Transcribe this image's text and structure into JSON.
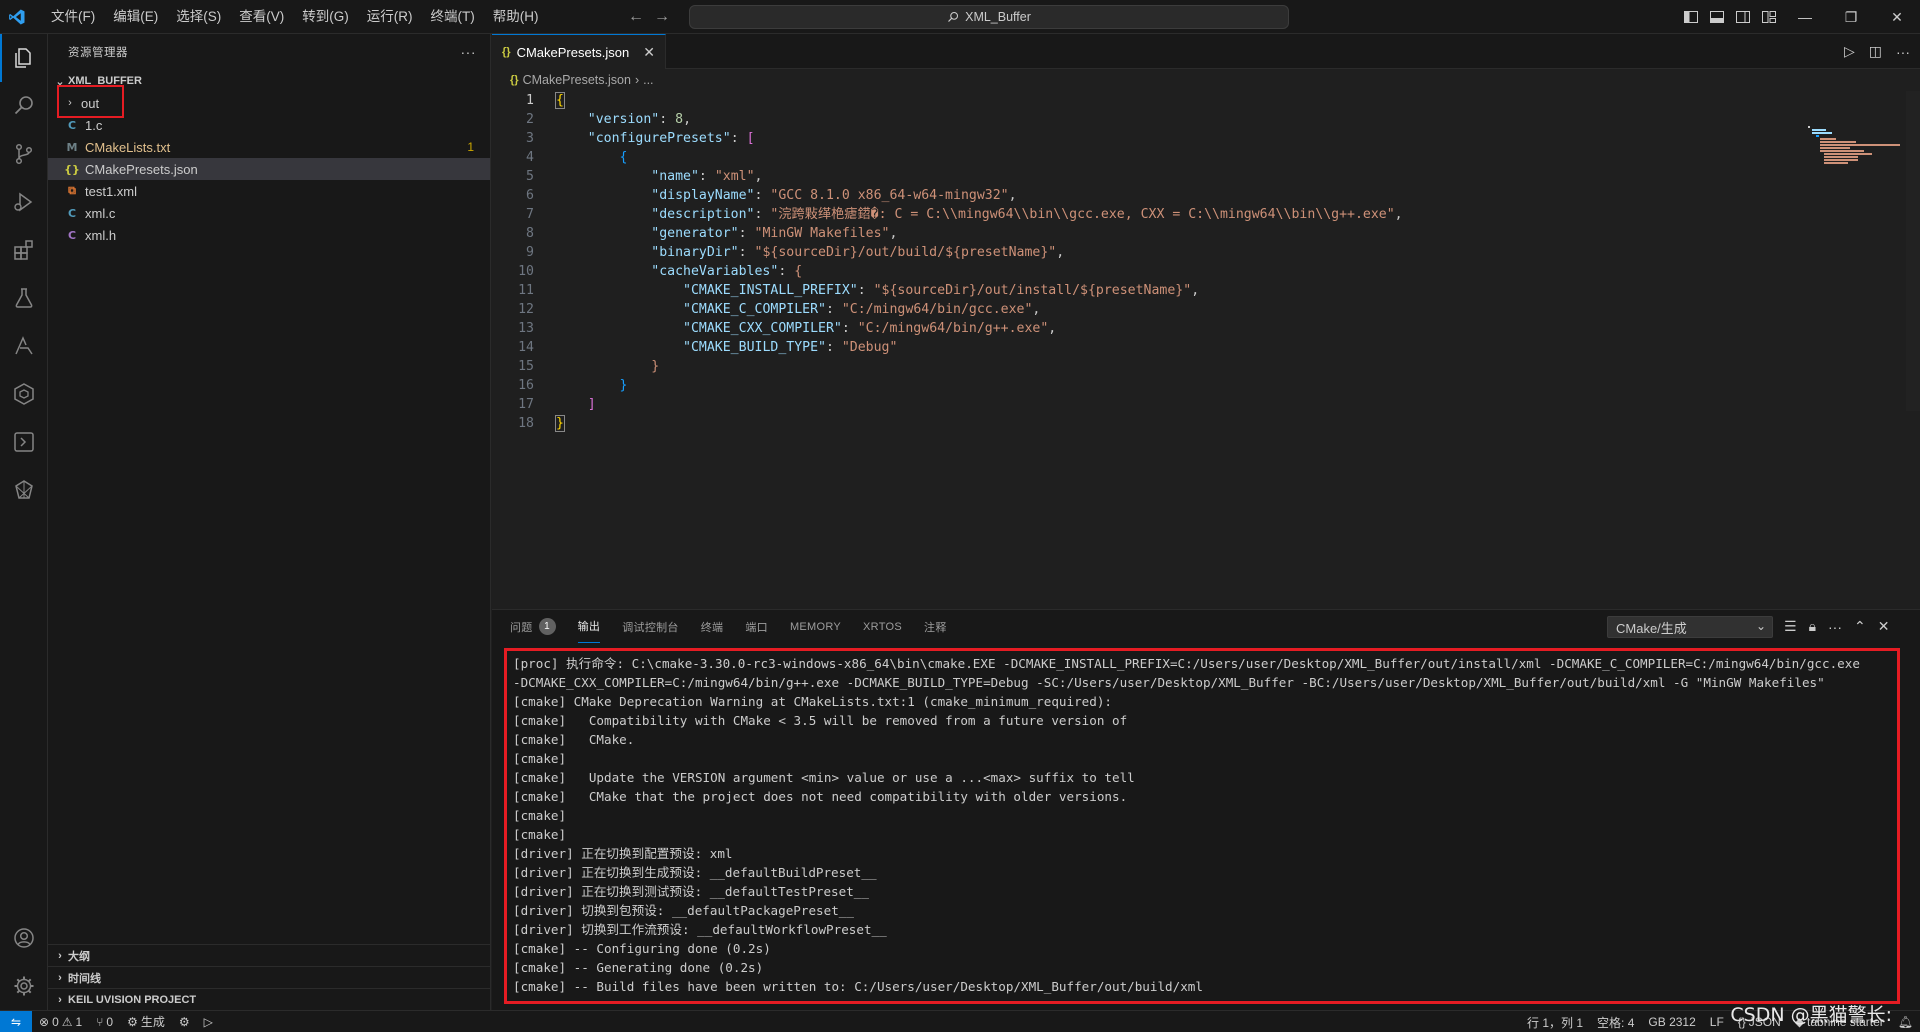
{
  "titlebar": {
    "menu": [
      "文件(F)",
      "编辑(E)",
      "选择(S)",
      "查看(V)",
      "转到(G)",
      "运行(R)",
      "终端(T)",
      "帮助(H)"
    ],
    "search_text": "XML_Buffer"
  },
  "sidebar": {
    "title": "资源管理器",
    "project": "XML_BUFFER",
    "items": [
      {
        "label": "out",
        "type": "folder"
      },
      {
        "label": "1.c",
        "type": "c"
      },
      {
        "label": "CMakeLists.txt",
        "type": "cmake",
        "badge": "1"
      },
      {
        "label": "CMakePresets.json",
        "type": "json"
      },
      {
        "label": "test1.xml",
        "type": "xml"
      },
      {
        "label": "xml.c",
        "type": "c"
      },
      {
        "label": "xml.h",
        "type": "h"
      }
    ],
    "bottom_sections": [
      "大纲",
      "时间线",
      "KEIL UVISION PROJECT"
    ]
  },
  "editor": {
    "tab_label": "CMakePresets.json",
    "breadcrumb_file": "CMakePresets.json",
    "breadcrumb_more": "...",
    "line_numbers": [
      "1",
      "2",
      "3",
      "4",
      "5",
      "6",
      "7",
      "8",
      "9",
      "10",
      "11",
      "12",
      "13",
      "14",
      "15",
      "16",
      "17",
      "18"
    ],
    "code": {
      "version_key": "\"version\"",
      "version_val": "8",
      "presets_key": "\"configurePresets\"",
      "name_key": "\"name\"",
      "name_val": "\"xml\"",
      "display_key": "\"displayName\"",
      "display_val": "\"GCC 8.1.0 x86_64-w64-mingw32\"",
      "desc_key": "\"description\"",
      "desc_val": "\"浣跨敤缂栬瘧鍣�: C = C:\\\\mingw64\\\\bin\\\\gcc.exe, CXX = C:\\\\mingw64\\\\bin\\\\g++.exe\"",
      "gen_key": "\"generator\"",
      "gen_val": "\"MinGW Makefiles\"",
      "bin_key": "\"binaryDir\"",
      "bin_val": "\"${sourceDir}/out/build/${presetName}\"",
      "cache_key": "\"cacheVariables\"",
      "inst_key": "\"CMAKE_INSTALL_PREFIX\"",
      "inst_val": "\"${sourceDir}/out/install/${presetName}\"",
      "cc_key": "\"CMAKE_C_COMPILER\"",
      "cc_val": "\"C:/mingw64/bin/gcc.exe\"",
      "cxx_key": "\"CMAKE_CXX_COMPILER\"",
      "cxx_val": "\"C:/mingw64/bin/g++.exe\"",
      "bt_key": "\"CMAKE_BUILD_TYPE\"",
      "bt_val": "\"Debug\""
    }
  },
  "panel": {
    "tabs": [
      {
        "label": "问题",
        "badge": "1"
      },
      {
        "label": "输出"
      },
      {
        "label": "调试控制台"
      },
      {
        "label": "终端"
      },
      {
        "label": "端口"
      },
      {
        "label": "MEMORY"
      },
      {
        "label": "XRTOS"
      },
      {
        "label": "注释"
      }
    ],
    "output_channel": "CMake/生成",
    "output_lines": [
      "[proc] 执行命令: C:\\cmake-3.30.0-rc3-windows-x86_64\\bin\\cmake.EXE -DCMAKE_INSTALL_PREFIX=C:/Users/user/Desktop/XML_Buffer/out/install/xml -DCMAKE_C_COMPILER=C:/mingw64/bin/gcc.exe",
      "-DCMAKE_CXX_COMPILER=C:/mingw64/bin/g++.exe -DCMAKE_BUILD_TYPE=Debug -SC:/Users/user/Desktop/XML_Buffer -BC:/Users/user/Desktop/XML_Buffer/out/build/xml -G \"MinGW Makefiles\"",
      "[cmake] CMake Deprecation Warning at CMakeLists.txt:1 (cmake_minimum_required):",
      "[cmake]   Compatibility with CMake < 3.5 will be removed from a future version of",
      "[cmake]   CMake.",
      "[cmake]",
      "[cmake]   Update the VERSION argument <min> value or use a ...<max> suffix to tell",
      "[cmake]   CMake that the project does not need compatibility with older versions.",
      "[cmake]",
      "[cmake]",
      "[driver] 正在切换到配置预设: xml",
      "[driver] 正在切换到生成预设: __defaultBuildPreset__",
      "[driver] 正在切换到测试预设: __defaultTestPreset__",
      "[driver] 切换到包预设: __defaultPackagePreset__",
      "[driver] 切换到工作流预设: __defaultWorkflowPreset__",
      "[cmake] -- Configuring done (0.2s)",
      "[cmake] -- Generating done (0.2s)",
      "[cmake] -- Build files have been written to: C:/Users/user/Desktop/XML_Buffer/out/build/xml"
    ]
  },
  "statusbar": {
    "errors": "0",
    "warnings": "1",
    "ports": "0",
    "build": "生成",
    "position": "行 1，列 1",
    "spaces": "空格: 4",
    "encoding": "GB 2312",
    "eol": "LF",
    "language": "JSON",
    "tabnine": "tabnine starter"
  },
  "watermark": "CSDN @黑猫警长:"
}
